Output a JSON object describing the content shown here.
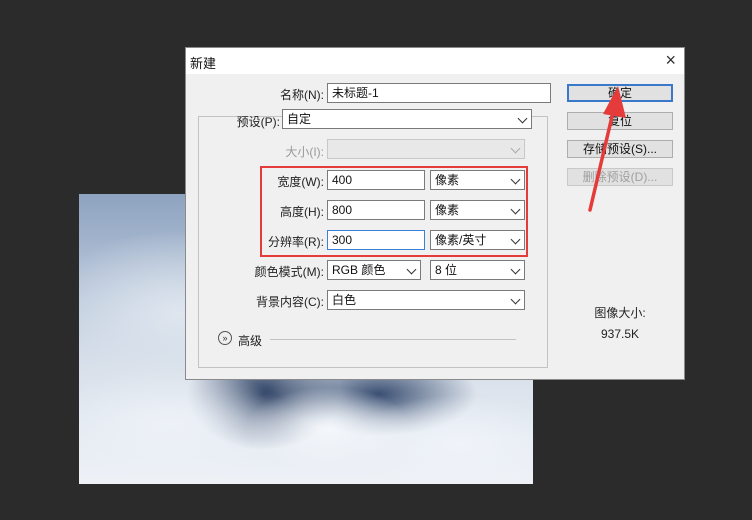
{
  "dialog": {
    "title": "新建",
    "close_glyph": "×"
  },
  "form": {
    "name": {
      "label": "名称(N):",
      "value": "未标题-1"
    },
    "preset": {
      "label": "预设(P):",
      "value": "自定"
    },
    "size": {
      "label": "大小(I):",
      "value": ""
    },
    "width": {
      "label": "宽度(W):",
      "value": "400",
      "unit": "像素"
    },
    "height": {
      "label": "高度(H):",
      "value": "800",
      "unit": "像素"
    },
    "resolution": {
      "label": "分辨率(R):",
      "value": "300",
      "unit": "像素/英寸"
    },
    "color_mode": {
      "label": "颜色模式(M):",
      "value": "RGB 颜色",
      "bits": "8 位"
    },
    "background": {
      "label": "背景内容(C):",
      "value": "白色"
    },
    "advanced": {
      "label": "高级",
      "icon": "expand-icon"
    }
  },
  "buttons": {
    "ok": "确定",
    "reset": "复位",
    "save_preset": "存储预设(S)...",
    "delete_preset": "删除预设(D)..."
  },
  "image_size": {
    "label": "图像大小:",
    "value": "937.5K"
  },
  "annotation": {
    "highlight_color": "#e53b3b",
    "arrow_color": "#e53b3b"
  }
}
